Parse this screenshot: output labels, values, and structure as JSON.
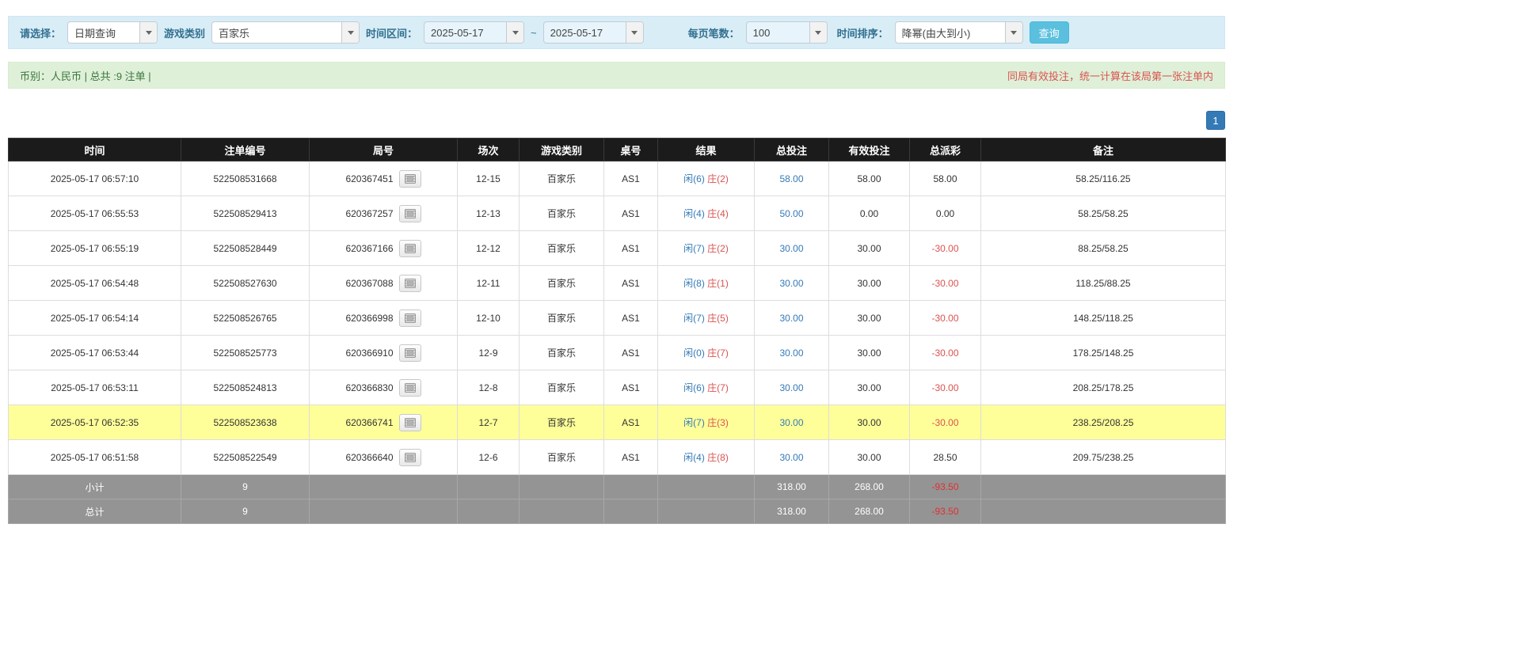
{
  "filters": {
    "select_label": "请选择：",
    "select_value": "日期查询",
    "game_label": "游戏类别",
    "game_value": "百家乐",
    "time_label": "时间区间：",
    "date_from": "2025-05-17",
    "range_separator": "~",
    "date_to": "2025-05-17",
    "page_size_label": "每页笔数：",
    "page_size_value": "100",
    "sort_label": "时间排序：",
    "sort_value": "降幂(由大到小)",
    "query_button": "查询"
  },
  "summary": {
    "left": "币别：人民币 | 总共 :9 注单 |",
    "right": "同局有效投注，统一计算在该局第一张注单内"
  },
  "pagination": {
    "current": "1"
  },
  "icons": {
    "combo_toggle": "chevron-down-icon",
    "round_action": "video-replay-icon"
  },
  "colors": {
    "filter_bar_bg": "#d9edf7",
    "summary_bar_bg": "#dff0d8",
    "header_bg": "#1b1b1b",
    "footer_bg": "#949494",
    "highlight_row_bg": "#ffff99",
    "link_blue": "#337ab7",
    "danger_red": "#d9534f",
    "query_button_bg": "#5bc0de"
  },
  "table": {
    "headers": [
      "时间",
      "注单编号",
      "局号",
      "场次",
      "游戏类别",
      "桌号",
      "结果",
      "总投注",
      "有效投注",
      "总派彩",
      "备注"
    ],
    "rows": [
      {
        "time": "2025-05-17 06:57:10",
        "bet_id": "522508531668",
        "round": "620367451",
        "session": "12-15",
        "game": "百家乐",
        "table_no": "AS1",
        "result_player": "闲(6)",
        "result_banker": "庄(2)",
        "total_bet": "58.00",
        "valid_bet": "58.00",
        "payout": "58.00",
        "remark": "58.25/116.25",
        "highlight": false
      },
      {
        "time": "2025-05-17 06:55:53",
        "bet_id": "522508529413",
        "round": "620367257",
        "session": "12-13",
        "game": "百家乐",
        "table_no": "AS1",
        "result_player": "闲(4)",
        "result_banker": "庄(4)",
        "total_bet": "50.00",
        "valid_bet": "0.00",
        "payout": "0.00",
        "remark": "58.25/58.25",
        "highlight": false
      },
      {
        "time": "2025-05-17 06:55:19",
        "bet_id": "522508528449",
        "round": "620367166",
        "session": "12-12",
        "game": "百家乐",
        "table_no": "AS1",
        "result_player": "闲(7)",
        "result_banker": "庄(2)",
        "total_bet": "30.00",
        "valid_bet": "30.00",
        "payout": "-30.00",
        "remark": "88.25/58.25",
        "highlight": false
      },
      {
        "time": "2025-05-17 06:54:48",
        "bet_id": "522508527630",
        "round": "620367088",
        "session": "12-11",
        "game": "百家乐",
        "table_no": "AS1",
        "result_player": "闲(8)",
        "result_banker": "庄(1)",
        "total_bet": "30.00",
        "valid_bet": "30.00",
        "payout": "-30.00",
        "remark": "118.25/88.25",
        "highlight": false
      },
      {
        "time": "2025-05-17 06:54:14",
        "bet_id": "522508526765",
        "round": "620366998",
        "session": "12-10",
        "game": "百家乐",
        "table_no": "AS1",
        "result_player": "闲(7)",
        "result_banker": "庄(5)",
        "total_bet": "30.00",
        "valid_bet": "30.00",
        "payout": "-30.00",
        "remark": "148.25/118.25",
        "highlight": false
      },
      {
        "time": "2025-05-17 06:53:44",
        "bet_id": "522508525773",
        "round": "620366910",
        "session": "12-9",
        "game": "百家乐",
        "table_no": "AS1",
        "result_player": "闲(0)",
        "result_banker": "庄(7)",
        "total_bet": "30.00",
        "valid_bet": "30.00",
        "payout": "-30.00",
        "remark": "178.25/148.25",
        "highlight": false
      },
      {
        "time": "2025-05-17 06:53:11",
        "bet_id": "522508524813",
        "round": "620366830",
        "session": "12-8",
        "game": "百家乐",
        "table_no": "AS1",
        "result_player": "闲(6)",
        "result_banker": "庄(7)",
        "total_bet": "30.00",
        "valid_bet": "30.00",
        "payout": "-30.00",
        "remark": "208.25/178.25",
        "highlight": false
      },
      {
        "time": "2025-05-17 06:52:35",
        "bet_id": "522508523638",
        "round": "620366741",
        "session": "12-7",
        "game": "百家乐",
        "table_no": "AS1",
        "result_player": "闲(7)",
        "result_banker": "庄(3)",
        "total_bet": "30.00",
        "valid_bet": "30.00",
        "payout": "-30.00",
        "remark": "238.25/208.25",
        "highlight": true
      },
      {
        "time": "2025-05-17 06:51:58",
        "bet_id": "522508522549",
        "round": "620366640",
        "session": "12-6",
        "game": "百家乐",
        "table_no": "AS1",
        "result_player": "闲(4)",
        "result_banker": "庄(8)",
        "total_bet": "30.00",
        "valid_bet": "30.00",
        "payout": "28.50",
        "remark": "209.75/238.25",
        "highlight": false
      }
    ],
    "subtotal": {
      "label": "小计",
      "count": "9",
      "total_bet": "318.00",
      "valid_bet": "268.00",
      "payout": "-93.50"
    },
    "total": {
      "label": "总计",
      "count": "9",
      "total_bet": "318.00",
      "valid_bet": "268.00",
      "payout": "-93.50"
    }
  }
}
